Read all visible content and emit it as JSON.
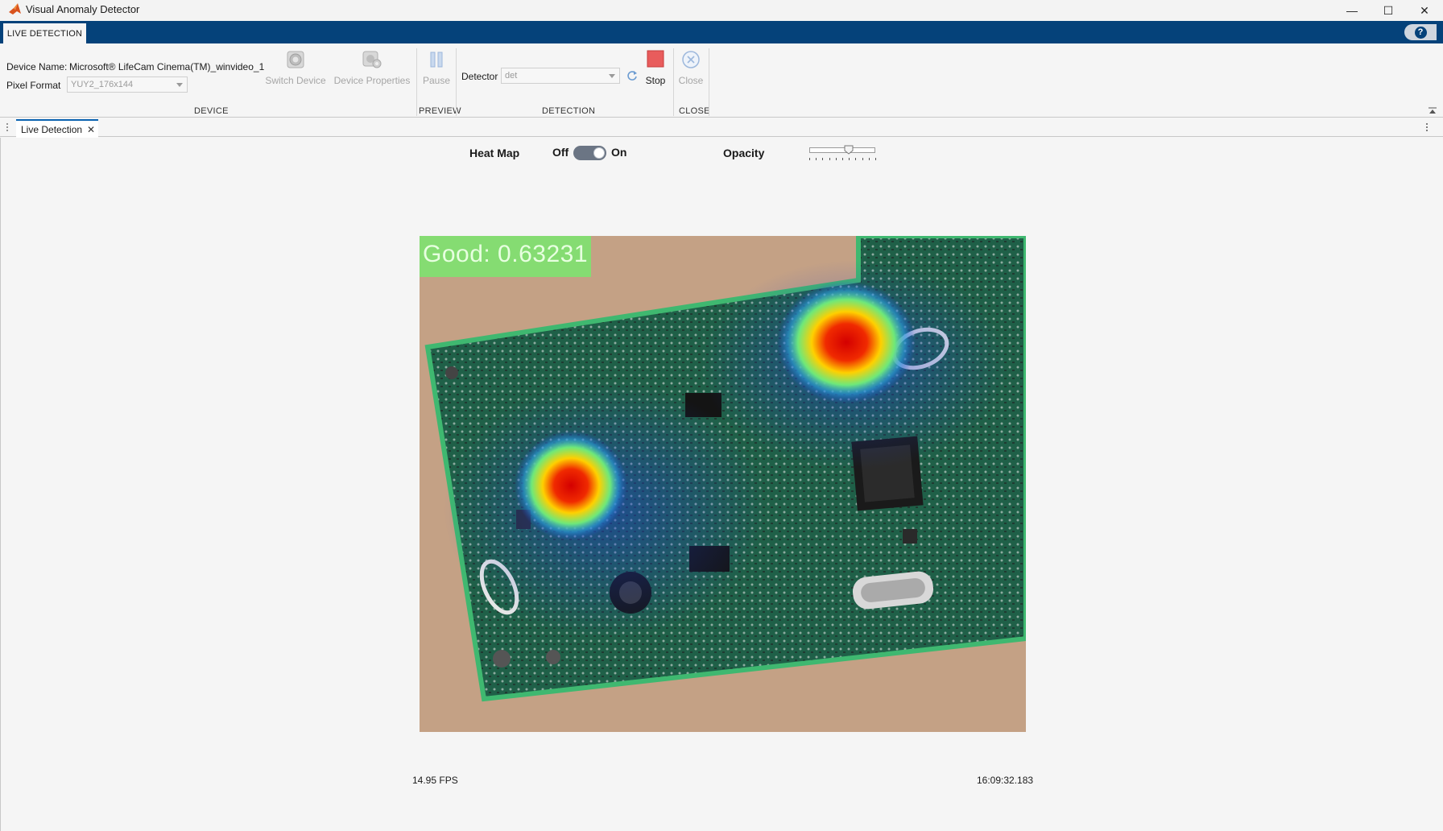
{
  "window": {
    "title": "Visual Anomaly Detector",
    "minimize": "—",
    "maximize": "☐",
    "close": "✕"
  },
  "ribbon": {
    "tab_label": "LIVE DETECTION",
    "help": "?"
  },
  "device": {
    "name_label": "Device Name:",
    "name_value": "Microsoft® LifeCam Cinema(TM)_winvideo_1",
    "pixel_format_label": "Pixel Format",
    "pixel_format_value": "YUY2_176x144",
    "switch_device": "Switch Device",
    "device_properties": "Device Properties",
    "section": "DEVICE"
  },
  "preview": {
    "pause": "Pause",
    "section": "PREVIEW"
  },
  "detection": {
    "detector_label": "Detector",
    "detector_value": "det",
    "stop": "Stop",
    "section": "DETECTION"
  },
  "close_section": {
    "close": "Close",
    "section": "CLOSE"
  },
  "doc_tab": {
    "label": "Live Detection",
    "close": "✕"
  },
  "controls": {
    "heat_map_label": "Heat Map",
    "toggle_off": "Off",
    "toggle_on": "On",
    "heat_map_on": true,
    "opacity_label": "Opacity",
    "opacity_value": 0.6
  },
  "result": {
    "label": "Good: 0.63231"
  },
  "status": {
    "fps": "14.95 FPS",
    "timestamp": "16:09:32.183"
  },
  "colors": {
    "ribbon_blue": "#05427a",
    "stop_red": "#e85c5c",
    "good_green": "#7ae66e"
  }
}
